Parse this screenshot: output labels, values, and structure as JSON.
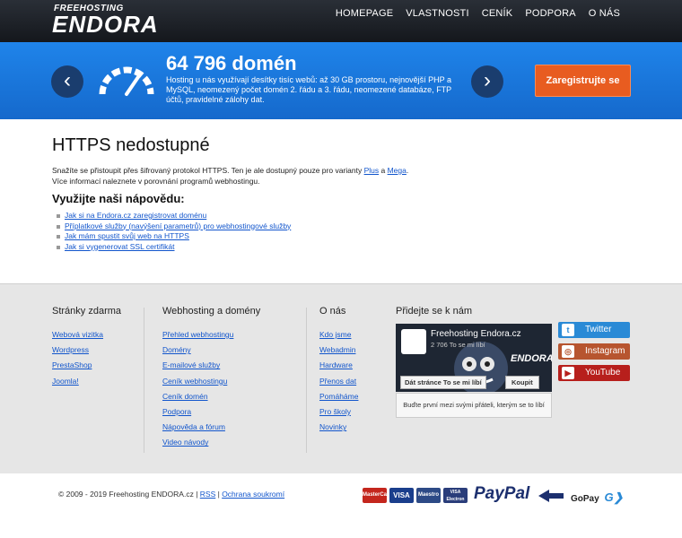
{
  "header": {
    "logo_small": "FREEHOSTING",
    "logo_big": "ENDORA",
    "nav": [
      "HOMEPAGE",
      "VLASTNOSTI",
      "CENÍK",
      "PODPORA",
      "O NÁS"
    ]
  },
  "banner": {
    "title": "64 796 domén",
    "description": "Hosting u nás využívají desítky tisíc webů: až 30 GB prostoru, nejnovější PHP a MySQL, neomezený počet domén 2. řádu a 3. řádu, neomezené databáze, FTP účtů, pravidelné zálohy dat.",
    "cta": "Zaregistrujte se",
    "prev_icon": "chevron-left-icon",
    "next_icon": "chevron-right-icon"
  },
  "main": {
    "title": "HTTPS nedostupné",
    "msg_part1": "Snažíte se přistoupit přes šifrovaný protokol HTTPS. Ten je ale dostupný pouze pro varianty ",
    "msg_link1": "Plus",
    "msg_mid": " a ",
    "msg_link2": "Mega",
    "msg_end": ".",
    "msg_line2": "Více informací naleznete v porovnání programů webhostingu.",
    "help_title": "Využijte naši nápovědu:",
    "help_links": [
      "Jak si na Endora.cz zaregistrovat doménu",
      "Příplatkové služby (navýšení parametrů) pro webhostingové služby",
      "Jak mám spustit svůj web na HTTPS",
      "Jak si vygenerovat SSL certifikát"
    ]
  },
  "footer": {
    "col1": {
      "title": "Stránky zdarma",
      "links": [
        "Webová vizitka",
        "Wordpress",
        "PrestaShop",
        "Joomla!"
      ]
    },
    "col2": {
      "title": "Webhosting a domény",
      "links": [
        "Přehled webhostingu",
        "Domény",
        "E-mailové služby",
        "Ceník webhostingu",
        "Ceník domén",
        "Podpora",
        "Nápověda a fórum",
        "Video návody"
      ]
    },
    "col3": {
      "title": "O nás",
      "links": [
        "Kdo jsme",
        "Webadmin",
        "Hardware",
        "Přenos dat",
        "Pomáháme",
        "Pro školy",
        "Novinky"
      ]
    },
    "col4": {
      "title": "Přidejte se k nám"
    },
    "fb": {
      "name": "Freehosting Endora.cz",
      "likes": "2 706 To se mi líbí",
      "like_btn": "Dát stránce To se mi líbí",
      "buy_btn": "Koupit",
      "friends": "Buďte první mezi svými přáteli, kterým se to líbí"
    },
    "social": [
      "Twitter",
      "Instagram",
      "YouTube"
    ]
  },
  "bottom": {
    "copyright": "© 2009 - 2019 Freehosting ENDORA.cz | ",
    "rss": "RSS",
    "sep": " | ",
    "privacy": "Ochrana soukromí",
    "payments": [
      "MasterCard",
      "VISA",
      "Maestro",
      "VISA Electron"
    ],
    "paypal": "PayPal",
    "gopay": "GoPay"
  }
}
